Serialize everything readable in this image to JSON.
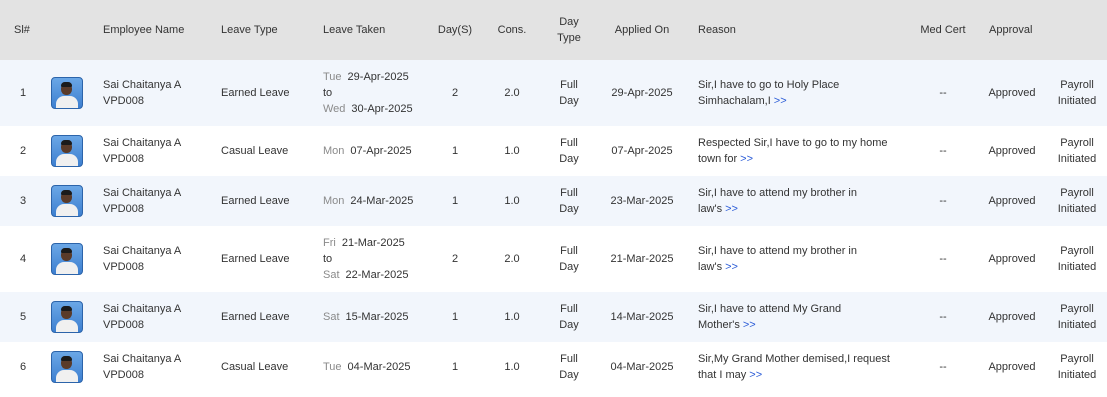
{
  "headers": {
    "sl": "Sl#",
    "employee_name": "Employee Name",
    "leave_type": "Leave Type",
    "leave_taken": "Leave Taken",
    "days": "Day(S)",
    "cons": "Cons.",
    "day_type_line1": "Day",
    "day_type_line2": "Type",
    "applied_on": "Applied On",
    "reason": "Reason",
    "med_cert": "Med Cert",
    "approval": "Approval"
  },
  "rows": [
    {
      "sl": "1",
      "name": "Sai Chaitanya A",
      "code": "VPD008",
      "leave_type": "Earned Leave",
      "from_day": "Tue",
      "from_date": "29-Apr-2025",
      "to_label": "to",
      "to_day": "Wed",
      "to_date": "30-Apr-2025",
      "days": "2",
      "cons": "2.0",
      "day_type_1": "Full",
      "day_type_2": "Day",
      "applied_on": "29-Apr-2025",
      "reason_1": "Sir,I have to go to Holy Place",
      "reason_2": "Simhachalam,I",
      "more": ">>",
      "med_cert": "--",
      "approval": "Approved",
      "status_1": "Payroll",
      "status_2": "Initiated"
    },
    {
      "sl": "2",
      "name": "Sai Chaitanya A",
      "code": "VPD008",
      "leave_type": "Casual Leave",
      "from_day": "Mon",
      "from_date": "07-Apr-2025",
      "days": "1",
      "cons": "1.0",
      "day_type_1": "Full",
      "day_type_2": "Day",
      "applied_on": "07-Apr-2025",
      "reason_1": "Respected Sir,I have to go to my home",
      "reason_2": "town for",
      "more": ">>",
      "med_cert": "--",
      "approval": "Approved",
      "status_1": "Payroll",
      "status_2": "Initiated"
    },
    {
      "sl": "3",
      "name": "Sai Chaitanya A",
      "code": "VPD008",
      "leave_type": "Earned Leave",
      "from_day": "Mon",
      "from_date": "24-Mar-2025",
      "days": "1",
      "cons": "1.0",
      "day_type_1": "Full",
      "day_type_2": "Day",
      "applied_on": "23-Mar-2025",
      "reason_1": "Sir,I have to attend my brother in",
      "reason_2": "law's",
      "more": ">>",
      "med_cert": "--",
      "approval": "Approved",
      "status_1": "Payroll",
      "status_2": "Initiated"
    },
    {
      "sl": "4",
      "name": "Sai Chaitanya A",
      "code": "VPD008",
      "leave_type": "Earned Leave",
      "from_day": "Fri",
      "from_date": "21-Mar-2025",
      "to_label": "to",
      "to_day": "Sat",
      "to_date": "22-Mar-2025",
      "days": "2",
      "cons": "2.0",
      "day_type_1": "Full",
      "day_type_2": "Day",
      "applied_on": "21-Mar-2025",
      "reason_1": "Sir,I have to attend my brother in",
      "reason_2": "law's",
      "more": ">>",
      "med_cert": "--",
      "approval": "Approved",
      "status_1": "Payroll",
      "status_2": "Initiated"
    },
    {
      "sl": "5",
      "name": "Sai Chaitanya A",
      "code": "VPD008",
      "leave_type": "Earned Leave",
      "from_day": "Sat",
      "from_date": "15-Mar-2025",
      "days": "1",
      "cons": "1.0",
      "day_type_1": "Full",
      "day_type_2": "Day",
      "applied_on": "14-Mar-2025",
      "reason_1": "Sir,I have to attend My Grand",
      "reason_2": "Mother's",
      "more": ">>",
      "med_cert": "--",
      "approval": "Approved",
      "status_1": "Payroll",
      "status_2": "Initiated"
    },
    {
      "sl": "6",
      "name": "Sai Chaitanya A",
      "code": "VPD008",
      "leave_type": "Casual Leave",
      "from_day": "Tue",
      "from_date": "04-Mar-2025",
      "days": "1",
      "cons": "1.0",
      "day_type_1": "Full",
      "day_type_2": "Day",
      "applied_on": "04-Mar-2025",
      "reason_1": "Sir,My Grand Mother demised,I request",
      "reason_2": "that I may",
      "more": ">>",
      "med_cert": "--",
      "approval": "Approved",
      "status_1": "Payroll",
      "status_2": "Initiated"
    }
  ]
}
